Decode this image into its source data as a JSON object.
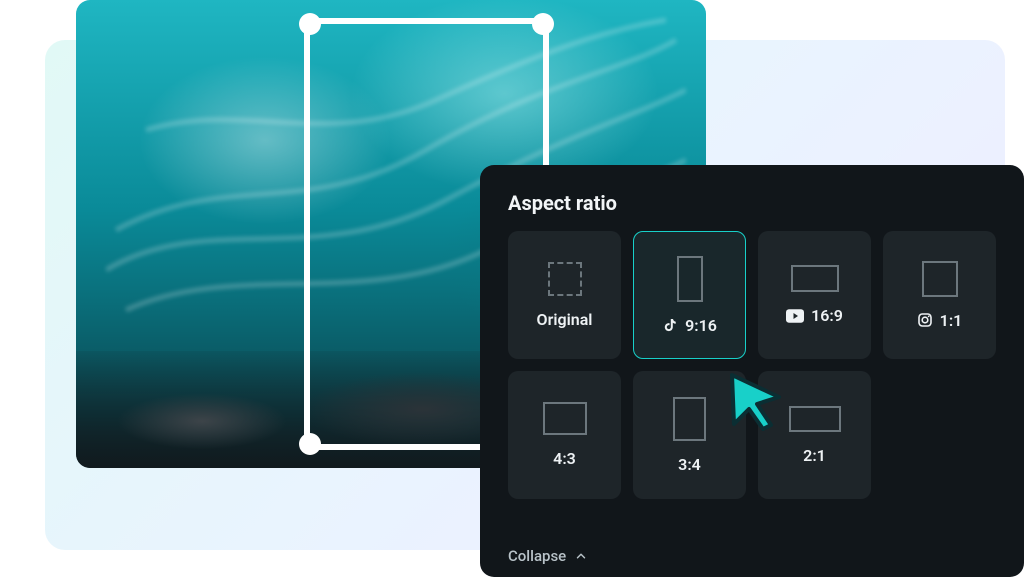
{
  "panel": {
    "title": "Aspect ratio",
    "collapse_label": "Collapse"
  },
  "ratios": {
    "original": {
      "label": "Original"
    },
    "r9x16": {
      "label": "9:16",
      "platform": "tiktok"
    },
    "r16x9": {
      "label": "16:9",
      "platform": "youtube"
    },
    "r1x1": {
      "label": "1:1",
      "platform": "instagram"
    },
    "r4x3": {
      "label": "4:3"
    },
    "r3x4": {
      "label": "3:4"
    },
    "r2x1": {
      "label": "2:1"
    }
  },
  "selected_ratio": "r9x16"
}
